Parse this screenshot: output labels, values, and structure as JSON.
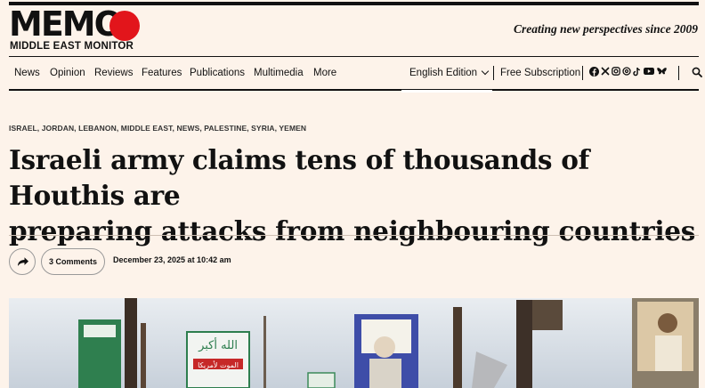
{
  "brand": {
    "logo_text": "MEMO",
    "logo_subtitle": "MIDDLE EAST MONITOR",
    "tagline": "Creating new perspectives since 2009",
    "accent_color": "#e2151b"
  },
  "nav": {
    "items": [
      "News",
      "Opinion",
      "Reviews",
      "Features",
      "Publications",
      "Multimedia",
      "More"
    ],
    "edition_label": "English Edition",
    "subscription_label": "Free Subscription",
    "social_icons": [
      "facebook-icon",
      "x-icon",
      "instagram-icon",
      "threads-icon",
      "tiktok-icon",
      "youtube-icon",
      "bluesky-icon"
    ]
  },
  "article": {
    "categories": "ISRAEL, JORDAN, LEBANON, MIDDLE EAST, NEWS, PALESTINE, SYRIA, YEMEN",
    "headline_line1": "Israeli army claims tens of thousands of Houthis are",
    "headline_line2": "preparing attacks from neighbouring countries",
    "comments_label": "3 Comments",
    "date": "December 23, 2025 at 10:42 am"
  },
  "hero_image": {
    "sign_left_text": "الله أكبر",
    "sign_left_sub": "الموت لأمريكا"
  }
}
